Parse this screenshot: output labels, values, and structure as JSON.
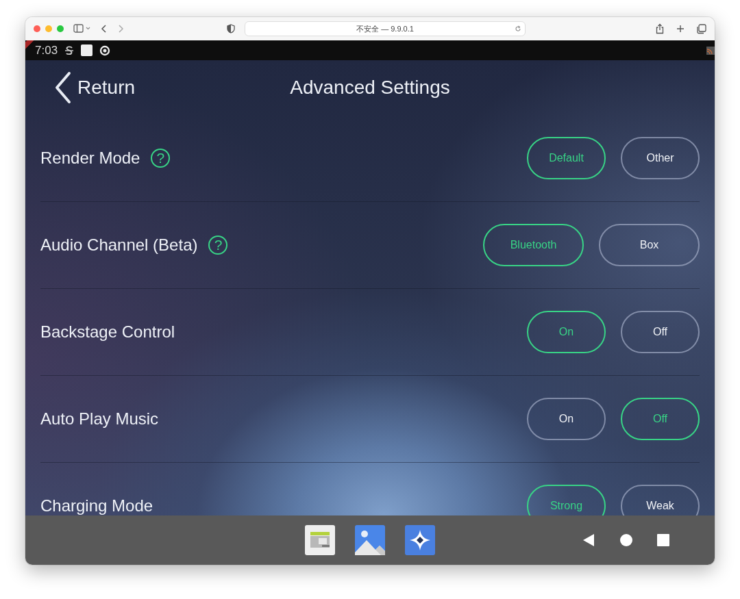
{
  "browser": {
    "address": "不安全 — 9.9.0.1"
  },
  "status_bar": {
    "time": "7:03"
  },
  "header": {
    "back_label": "Return",
    "title": "Advanced Settings"
  },
  "settings": [
    {
      "label": "Render Mode",
      "help": "?",
      "options": [
        {
          "label": "Default",
          "selected": true
        },
        {
          "label": "Other",
          "selected": false
        }
      ]
    },
    {
      "label": "Audio Channel (Beta)",
      "help": "?",
      "options": [
        {
          "label": "Bluetooth",
          "selected": true
        },
        {
          "label": "Box",
          "selected": false
        }
      ]
    },
    {
      "label": "Backstage Control",
      "options": [
        {
          "label": "On",
          "selected": true
        },
        {
          "label": "Off",
          "selected": false
        }
      ]
    },
    {
      "label": "Auto Play Music",
      "options": [
        {
          "label": "On",
          "selected": false
        },
        {
          "label": "Off",
          "selected": true
        }
      ]
    },
    {
      "label": "Charging Mode",
      "options": [
        {
          "label": "Strong",
          "selected": true
        },
        {
          "label": "Weak",
          "selected": false
        }
      ]
    }
  ]
}
